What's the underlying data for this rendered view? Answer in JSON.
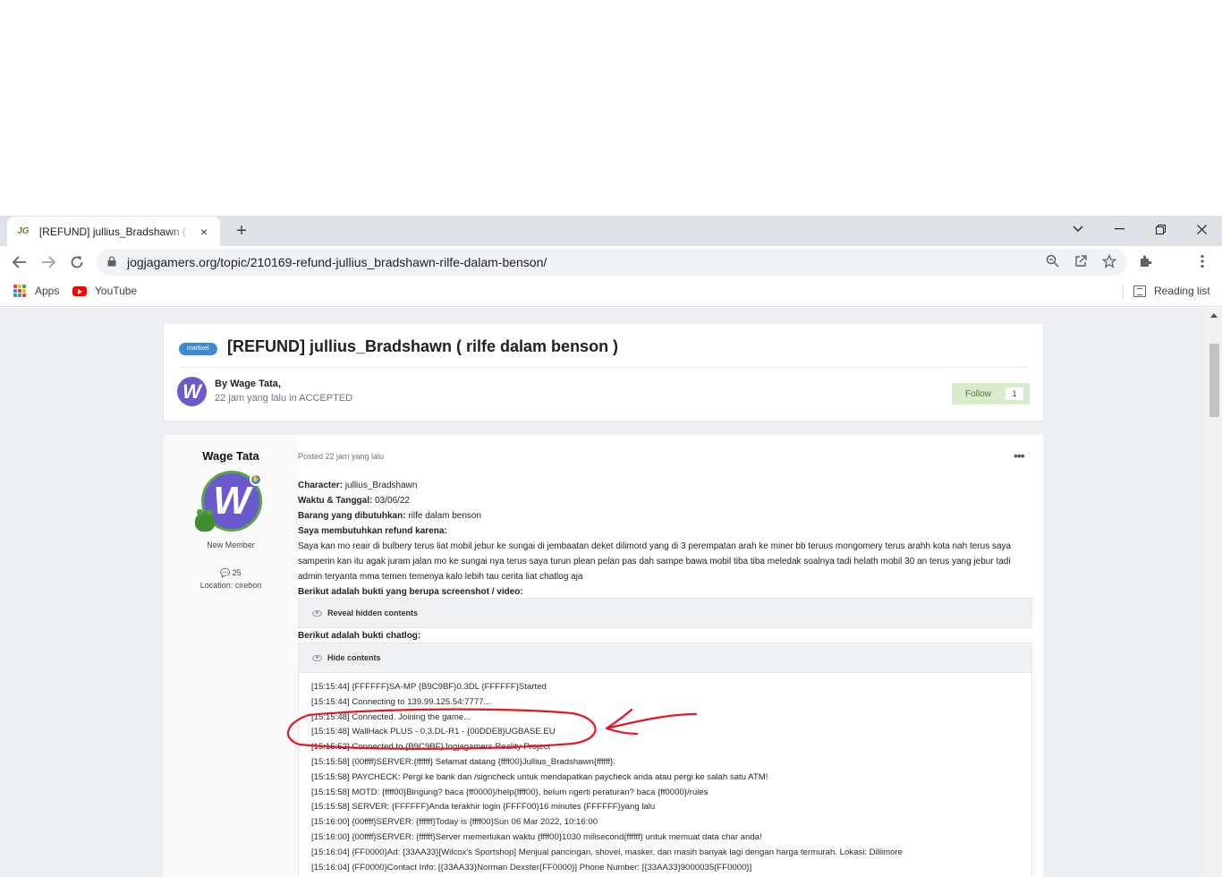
{
  "browser": {
    "tab_title": "[REFUND] jullius_Bradshawn ( rilfe dalam benson )",
    "favicon_text": "JG",
    "tab_close": "×",
    "new_tab": "+",
    "url": "jogjagamers.org/topic/210169-refund-jullius_bradshawn-rilfe-dalam-benson/",
    "bookmarks": [
      {
        "label": "Apps",
        "icon": "apps-grid-icon"
      },
      {
        "label": "YouTube",
        "icon": "youtube-icon"
      }
    ],
    "reading_list": "Reading list",
    "apps_colors": [
      "#ea4335",
      "#fbbc05",
      "#34a853",
      "#4285f4",
      "#ea4335",
      "#fbbc05",
      "#34a853",
      "#4285f4",
      "#ea4335"
    ]
  },
  "topic": {
    "prefix": "martixel",
    "title": "[REFUND] jullius_Bradshawn ( rilfe dalam benson )",
    "author_avatar_letter": "W",
    "by_line": "By Wage Tata,",
    "date_line": "22 jam yang lalu in ACCEPTED",
    "follow_label": "Follow",
    "follow_count": "1"
  },
  "post": {
    "author": "Wage Tata",
    "avatar_letter": "W",
    "rank": "New Member",
    "post_count": "25",
    "location": "Location: cirebon",
    "posted": "Posted 22 jam yang lalu",
    "more": "•••",
    "fields": [
      {
        "label": "Character:",
        "value": " jullius_Bradshawn"
      },
      {
        "label": "Waktu & Tanggal:",
        "value": " 03/06/22"
      },
      {
        "label": "Barang yang dibutuhkan:",
        "value": " rilfe dalam benson"
      },
      {
        "label": "Saya membutuhkan refund karena:",
        "value": ""
      }
    ],
    "reason": "Saya kan mo reair di bulbery terus liat mobil jebur ke sungai di jembaatan deket dilimord yang di 3 perempatan arah ke miner bb teruus mongomery terus arahh kota nah terus saya samperin kan itu agak juram jalan mo ke sungai nya terus saya turun plean pelan pas dah sampe bawa mobil tiba tiba meledak soalnya tadi helath mobil 30 an terus yang jebur tadi admin teryanta mma temen temenya kalo lebih tau cerita liat chatlog aja",
    "screenshot_heading": "Berikut adalah bukti yang berupa screenshot / video:",
    "reveal_label": "Reveal hidden contents",
    "chatlog_heading": "Berikut adalah bukti chatlog:",
    "hide_label": "Hide contents",
    "chatlog": [
      "[15:15:44] {FFFFFF}SA-MP {B9C9BF}0.3DL {FFFFFF}Started",
      "[15:15:44] Connecting to 139.99.125.54:7777...",
      "[15:15:48] Connected. Joining the game...",
      "[15:15:48] WallHack PLUS - 0.3.DL-R1 - {00DDE8}UGBASE.EU",
      "[15:15:52] Connected to {B9C9BF}Jogjagamers Reality Project",
      "[15:15:58] {00ffff}SERVER:{ffffff} Selamat datang {ffff00}Jullius_Bradshawn{ffffff}.",
      "[15:15:58] PAYCHECK: Pergi ke bank dan /signcheck untuk mendapatkan paycheck anda atau pergi ke salah satu ATM!",
      "[15:15:58] MOTD: {ffff00}Bingung? baca {ff0000}/help{ffff00}, belum ngerti peraturan? baca {ff0000}/rules",
      "[15:15:58] SERVER: {FFFFFF}Anda terakhir login {FFFF00}16 minutes {FFFFFF}yang lalu",
      "[15:16:00] {00ffff}SERVER: {ffffff}Today is {ffff00}Sun 06 Mar 2022, 10:16:00",
      "[15:16:00] {00ffff}SERVER: {ffffff}Server memerlukan waktu {ffff00}1030 milisecond{ffffff} untuk memuat data char anda!",
      "[15:16:04] {FF0000}Ad: {33AA33}[Wilcox's Sportshop] Menjual pancingan, shovel, masker, dan masih banyak lagi dengan harga termurah. Lokasi: Dillimore",
      "[15:16:04] {FF0000}Contact Info: [{33AA33}Norman Dexster{FF0000}] Phone Number: [{33AA33}9000035{FF0000}]"
    ]
  },
  "colors": {
    "annotation": "#e8141e",
    "badge": "#3d8ad3",
    "follow_bg": "#d8eccd"
  }
}
